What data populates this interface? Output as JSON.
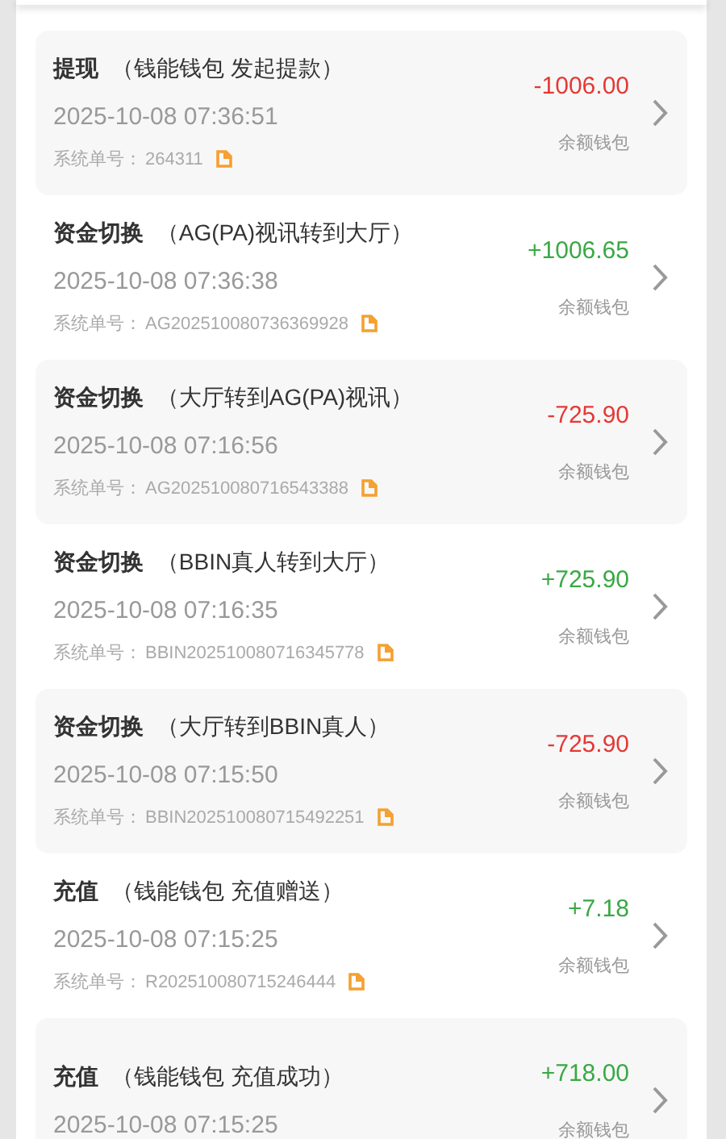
{
  "records": [
    {
      "title": "提现",
      "detail": "（钱能钱包 发起提款）",
      "time": "2025-10-08 07:36:51",
      "order_label": "系统单号：",
      "order_no": "264311",
      "amount": "-1006.00",
      "color": "#e53935",
      "wallet": "余额钱包"
    },
    {
      "title": "资金切换",
      "detail": "（AG(PA)视讯转到大厅）",
      "time": "2025-10-08 07:36:38",
      "order_label": "系统单号：",
      "order_no": "AG202510080736369928",
      "amount": "+1006.65",
      "color": "#3aa845",
      "wallet": "余额钱包"
    },
    {
      "title": "资金切换",
      "detail": "（大厅转到AG(PA)视讯）",
      "time": "2025-10-08 07:16:56",
      "order_label": "系统单号：",
      "order_no": "AG202510080716543388",
      "amount": "-725.90",
      "color": "#e53935",
      "wallet": "余额钱包"
    },
    {
      "title": "资金切换",
      "detail": "（BBIN真人转到大厅）",
      "time": "2025-10-08 07:16:35",
      "order_label": "系统单号：",
      "order_no": "BBIN202510080716345778",
      "amount": "+725.90",
      "color": "#3aa845",
      "wallet": "余额钱包"
    },
    {
      "title": "资金切换",
      "detail": "（大厅转到BBIN真人）",
      "time": "2025-10-08 07:15:50",
      "order_label": "系统单号：",
      "order_no": "BBIN202510080715492251",
      "amount": "-725.90",
      "color": "#e53935",
      "wallet": "余额钱包"
    },
    {
      "title": "充值",
      "detail": "（钱能钱包 充值赠送）",
      "time": "2025-10-08 07:15:25",
      "order_label": "系统单号：",
      "order_no": "R202510080715246444",
      "amount": "+7.18",
      "color": "#3aa845",
      "wallet": "余额钱包"
    },
    {
      "title": "充值",
      "detail": "（钱能钱包 充值成功）",
      "time": "2025-10-08 07:15:25",
      "amount": "+718.00",
      "color": "#3aa845",
      "wallet": "余额钱包"
    }
  ]
}
